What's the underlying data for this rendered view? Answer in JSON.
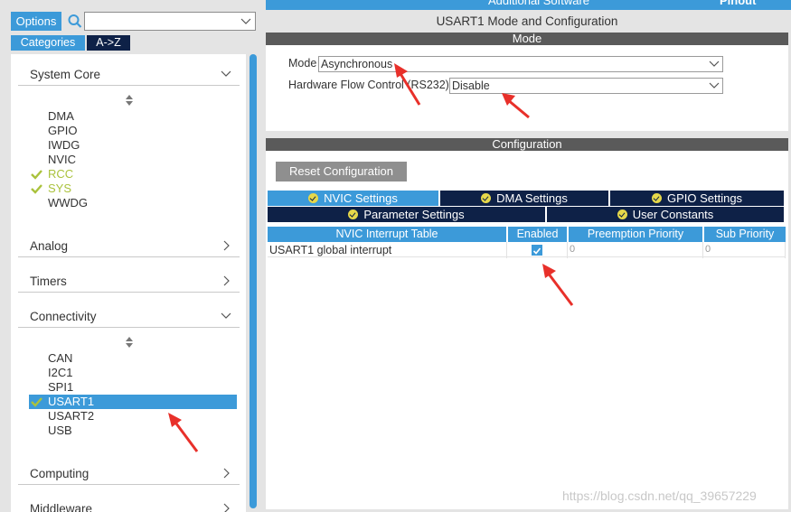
{
  "left": {
    "options_label": "Options",
    "search_placeholder": "",
    "categories_label": "Categories",
    "az_label": "A->Z",
    "categories": [
      {
        "label": "System Core",
        "expanded": true,
        "items": [
          {
            "label": "DMA",
            "status": "none"
          },
          {
            "label": "GPIO",
            "status": "none"
          },
          {
            "label": "IWDG",
            "status": "none"
          },
          {
            "label": "NVIC",
            "status": "none"
          },
          {
            "label": "RCC",
            "status": "ok-green"
          },
          {
            "label": "SYS",
            "status": "ok-green"
          },
          {
            "label": "WWDG",
            "status": "none"
          }
        ]
      },
      {
        "label": "Analog",
        "expanded": false
      },
      {
        "label": "Timers",
        "expanded": false
      },
      {
        "label": "Connectivity",
        "expanded": true,
        "items": [
          {
            "label": "CAN",
            "status": "none"
          },
          {
            "label": "I2C1",
            "status": "none"
          },
          {
            "label": "SPI1",
            "status": "none"
          },
          {
            "label": "USART1",
            "status": "selected"
          },
          {
            "label": "USART2",
            "status": "none"
          },
          {
            "label": "USB",
            "status": "none"
          }
        ]
      },
      {
        "label": "Computing",
        "expanded": false
      },
      {
        "label": "Middleware",
        "expanded": false
      }
    ]
  },
  "right": {
    "top_strip_label": "Additional Software",
    "top_strip_pinout": "Pinout",
    "title": "USART1 Mode and Configuration",
    "mode_section": "Mode",
    "mode_label": "Mode",
    "mode_value": "Asynchronous",
    "hw_label": "Hardware Flow Control (RS232)",
    "hw_value": "Disable",
    "config_section": "Configuration",
    "reset_label": "Reset Configuration",
    "tabs_row1": [
      "NVIC Settings",
      "DMA Settings",
      "GPIO Settings"
    ],
    "tabs_row2": [
      "Parameter Settings",
      "User Constants"
    ],
    "table": {
      "headers": [
        "NVIC Interrupt Table",
        "Enabled",
        "Preemption Priority",
        "Sub Priority"
      ],
      "rows": [
        {
          "name": "USART1 global interrupt",
          "enabled": true,
          "preemption": "0",
          "sub": "0"
        }
      ]
    }
  },
  "watermark": "https://blog.csdn.net/qq_39657229",
  "colors": {
    "accent": "#3c9ad9",
    "navy": "#0e2147",
    "section": "#5a5a5a",
    "green": "#aac23c",
    "arrow": "#e8302a"
  }
}
